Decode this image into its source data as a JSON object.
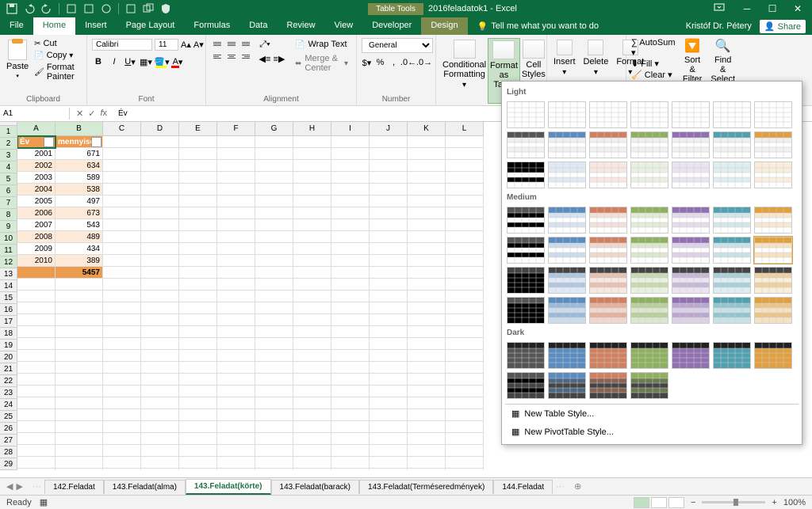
{
  "app": {
    "context_tab": "Table Tools",
    "title": "2016feladatok1 - Excel",
    "user": "Kristóf Dr. Pétery",
    "share": "Share"
  },
  "tabs": [
    "File",
    "Home",
    "Insert",
    "Page Layout",
    "Formulas",
    "Data",
    "Review",
    "View",
    "Developer",
    "Design"
  ],
  "tell_me": "Tell me what you want to do",
  "clipboard": {
    "label": "Clipboard",
    "paste": "Paste",
    "cut": "Cut",
    "copy": "Copy",
    "painter": "Format Painter"
  },
  "font": {
    "label": "Font",
    "name": "Calibri",
    "size": "11"
  },
  "alignment": {
    "label": "Alignment",
    "wrap": "Wrap Text",
    "merge": "Merge & Center"
  },
  "number": {
    "label": "Number",
    "format": "General"
  },
  "styles": {
    "cond": "Conditional\nFormatting",
    "format_table": "Format as\nTable",
    "cell": "Cell\nStyles"
  },
  "cells": {
    "insert": "Insert",
    "delete": "Delete",
    "format": "Format"
  },
  "editing": {
    "autosum": "AutoSum",
    "fill": "Fill",
    "clear": "Clear",
    "sort": "Sort &\nFilter",
    "find": "Find &\nSelect"
  },
  "namebox": "A1",
  "formula_value": "Év",
  "columns": [
    "A",
    "B",
    "C",
    "D",
    "E",
    "F",
    "G",
    "H",
    "I",
    "J",
    "K",
    "L"
  ],
  "headers": {
    "ev": "Év",
    "menny": "mennyiség"
  },
  "data_rows": [
    {
      "ev": "2001",
      "m": "671"
    },
    {
      "ev": "2002",
      "m": "634"
    },
    {
      "ev": "2003",
      "m": "589"
    },
    {
      "ev": "2004",
      "m": "538"
    },
    {
      "ev": "2005",
      "m": "497"
    },
    {
      "ev": "2006",
      "m": "673"
    },
    {
      "ev": "2007",
      "m": "543"
    },
    {
      "ev": "2008",
      "m": "489"
    },
    {
      "ev": "2009",
      "m": "434"
    },
    {
      "ev": "2010",
      "m": "389"
    }
  ],
  "total": "5457",
  "gallery": {
    "light": "Light",
    "medium": "Medium",
    "dark": "Dark",
    "new_table": "New Table Style...",
    "new_pivot": "New PivotTable Style..."
  },
  "sheets": [
    "142.Feladat",
    "143.Feladat(alma)",
    "143.Feladat(körte)",
    "143.Feladat(barack)",
    "143.Feladat(Terméseredmények)",
    "144.Feladat"
  ],
  "status": {
    "ready": "Ready",
    "zoom": "100%"
  }
}
